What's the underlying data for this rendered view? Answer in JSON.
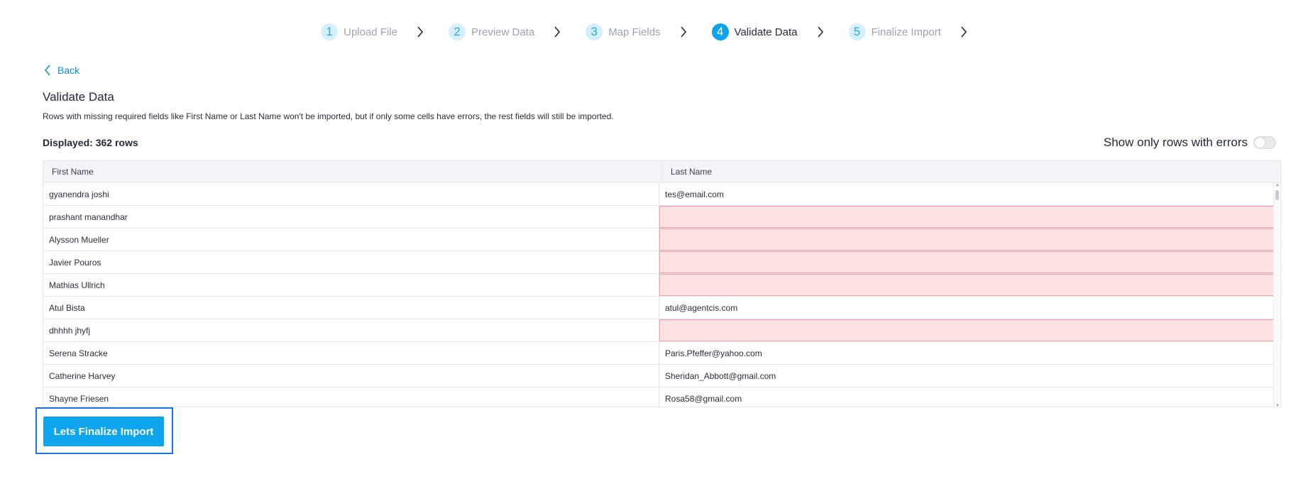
{
  "stepper": {
    "steps": [
      {
        "number": "1",
        "label": "Upload File",
        "active": false
      },
      {
        "number": "2",
        "label": "Preview Data",
        "active": false
      },
      {
        "number": "3",
        "label": "Map Fields",
        "active": false
      },
      {
        "number": "4",
        "label": "Validate Data",
        "active": true
      },
      {
        "number": "5",
        "label": "Finalize Import",
        "active": false
      }
    ]
  },
  "back_label": "Back",
  "page": {
    "title": "Validate Data",
    "subtitle": "Rows with missing required fields like First Name or Last Name won't be imported, but if only some cells have errors, the rest fields will still be imported.",
    "displayed": "Displayed: 362 rows",
    "toggle_label": "Show only rows with errors",
    "toggle_on": false
  },
  "table": {
    "columns": [
      "First Name",
      "Last Name"
    ],
    "rows": [
      {
        "first": "gyanendra joshi",
        "last": "tes@email.com",
        "last_error": false
      },
      {
        "first": "prashant manandhar",
        "last": "",
        "last_error": true
      },
      {
        "first": "Alysson Mueller",
        "last": "",
        "last_error": true
      },
      {
        "first": "Javier Pouros",
        "last": "",
        "last_error": true
      },
      {
        "first": "Mathias Ullrich",
        "last": "",
        "last_error": true
      },
      {
        "first": "Atul Bista",
        "last": "atul@agentcis.com",
        "last_error": false
      },
      {
        "first": "dhhhh jhyfj",
        "last": "",
        "last_error": true
      },
      {
        "first": "Serena Stracke",
        "last": "Paris.Pfeffer@yahoo.com",
        "last_error": false
      },
      {
        "first": "Catherine Harvey",
        "last": "Sheridan_Abbott@gmail.com",
        "last_error": false
      },
      {
        "first": "Shayne Friesen",
        "last": "Rosa58@gmail.com",
        "last_error": false
      }
    ]
  },
  "finalize_button": "Lets Finalize Import",
  "colors": {
    "accent": "#0ea5ef",
    "error_bg": "#ffe1e1",
    "error_border": "#f4a0a0",
    "highlight_frame": "#1a73e8"
  }
}
